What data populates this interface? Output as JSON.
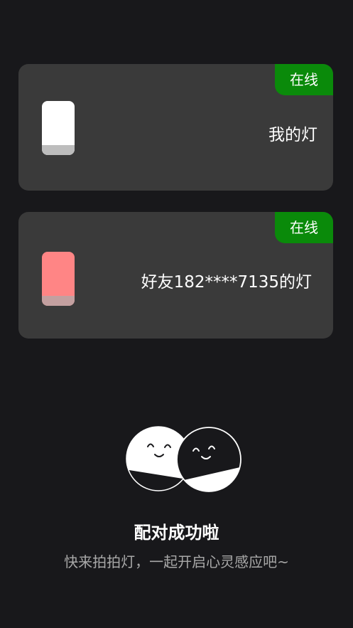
{
  "devices": [
    {
      "name": "我的灯",
      "status": "在线",
      "lamp_color": "#ffffff"
    },
    {
      "name": "好友182****7135的灯",
      "status": "在线",
      "lamp_color": "#ff8585"
    }
  ],
  "status_color": "#0a8a0a",
  "pairing": {
    "title": "配对成功啦",
    "subtitle": "快来拍拍灯，一起开启心灵感应吧~",
    "illustration": "paired-faces-icon"
  }
}
